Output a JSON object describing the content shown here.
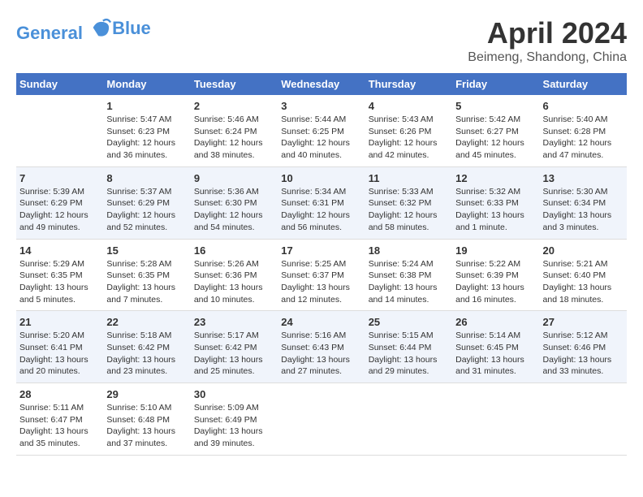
{
  "logo": {
    "line1": "General",
    "line2": "Blue"
  },
  "title": "April 2024",
  "subtitle": "Beimeng, Shandong, China",
  "days_header": [
    "Sunday",
    "Monday",
    "Tuesday",
    "Wednesday",
    "Thursday",
    "Friday",
    "Saturday"
  ],
  "weeks": [
    [
      {
        "day": "",
        "info": ""
      },
      {
        "day": "1",
        "info": "Sunrise: 5:47 AM\nSunset: 6:23 PM\nDaylight: 12 hours\nand 36 minutes."
      },
      {
        "day": "2",
        "info": "Sunrise: 5:46 AM\nSunset: 6:24 PM\nDaylight: 12 hours\nand 38 minutes."
      },
      {
        "day": "3",
        "info": "Sunrise: 5:44 AM\nSunset: 6:25 PM\nDaylight: 12 hours\nand 40 minutes."
      },
      {
        "day": "4",
        "info": "Sunrise: 5:43 AM\nSunset: 6:26 PM\nDaylight: 12 hours\nand 42 minutes."
      },
      {
        "day": "5",
        "info": "Sunrise: 5:42 AM\nSunset: 6:27 PM\nDaylight: 12 hours\nand 45 minutes."
      },
      {
        "day": "6",
        "info": "Sunrise: 5:40 AM\nSunset: 6:28 PM\nDaylight: 12 hours\nand 47 minutes."
      }
    ],
    [
      {
        "day": "7",
        "info": "Sunrise: 5:39 AM\nSunset: 6:29 PM\nDaylight: 12 hours\nand 49 minutes."
      },
      {
        "day": "8",
        "info": "Sunrise: 5:37 AM\nSunset: 6:29 PM\nDaylight: 12 hours\nand 52 minutes."
      },
      {
        "day": "9",
        "info": "Sunrise: 5:36 AM\nSunset: 6:30 PM\nDaylight: 12 hours\nand 54 minutes."
      },
      {
        "day": "10",
        "info": "Sunrise: 5:34 AM\nSunset: 6:31 PM\nDaylight: 12 hours\nand 56 minutes."
      },
      {
        "day": "11",
        "info": "Sunrise: 5:33 AM\nSunset: 6:32 PM\nDaylight: 12 hours\nand 58 minutes."
      },
      {
        "day": "12",
        "info": "Sunrise: 5:32 AM\nSunset: 6:33 PM\nDaylight: 13 hours\nand 1 minute."
      },
      {
        "day": "13",
        "info": "Sunrise: 5:30 AM\nSunset: 6:34 PM\nDaylight: 13 hours\nand 3 minutes."
      }
    ],
    [
      {
        "day": "14",
        "info": "Sunrise: 5:29 AM\nSunset: 6:35 PM\nDaylight: 13 hours\nand 5 minutes."
      },
      {
        "day": "15",
        "info": "Sunrise: 5:28 AM\nSunset: 6:35 PM\nDaylight: 13 hours\nand 7 minutes."
      },
      {
        "day": "16",
        "info": "Sunrise: 5:26 AM\nSunset: 6:36 PM\nDaylight: 13 hours\nand 10 minutes."
      },
      {
        "day": "17",
        "info": "Sunrise: 5:25 AM\nSunset: 6:37 PM\nDaylight: 13 hours\nand 12 minutes."
      },
      {
        "day": "18",
        "info": "Sunrise: 5:24 AM\nSunset: 6:38 PM\nDaylight: 13 hours\nand 14 minutes."
      },
      {
        "day": "19",
        "info": "Sunrise: 5:22 AM\nSunset: 6:39 PM\nDaylight: 13 hours\nand 16 minutes."
      },
      {
        "day": "20",
        "info": "Sunrise: 5:21 AM\nSunset: 6:40 PM\nDaylight: 13 hours\nand 18 minutes."
      }
    ],
    [
      {
        "day": "21",
        "info": "Sunrise: 5:20 AM\nSunset: 6:41 PM\nDaylight: 13 hours\nand 20 minutes."
      },
      {
        "day": "22",
        "info": "Sunrise: 5:18 AM\nSunset: 6:42 PM\nDaylight: 13 hours\nand 23 minutes."
      },
      {
        "day": "23",
        "info": "Sunrise: 5:17 AM\nSunset: 6:42 PM\nDaylight: 13 hours\nand 25 minutes."
      },
      {
        "day": "24",
        "info": "Sunrise: 5:16 AM\nSunset: 6:43 PM\nDaylight: 13 hours\nand 27 minutes."
      },
      {
        "day": "25",
        "info": "Sunrise: 5:15 AM\nSunset: 6:44 PM\nDaylight: 13 hours\nand 29 minutes."
      },
      {
        "day": "26",
        "info": "Sunrise: 5:14 AM\nSunset: 6:45 PM\nDaylight: 13 hours\nand 31 minutes."
      },
      {
        "day": "27",
        "info": "Sunrise: 5:12 AM\nSunset: 6:46 PM\nDaylight: 13 hours\nand 33 minutes."
      }
    ],
    [
      {
        "day": "28",
        "info": "Sunrise: 5:11 AM\nSunset: 6:47 PM\nDaylight: 13 hours\nand 35 minutes."
      },
      {
        "day": "29",
        "info": "Sunrise: 5:10 AM\nSunset: 6:48 PM\nDaylight: 13 hours\nand 37 minutes."
      },
      {
        "day": "30",
        "info": "Sunrise: 5:09 AM\nSunset: 6:49 PM\nDaylight: 13 hours\nand 39 minutes."
      },
      {
        "day": "",
        "info": ""
      },
      {
        "day": "",
        "info": ""
      },
      {
        "day": "",
        "info": ""
      },
      {
        "day": "",
        "info": ""
      }
    ]
  ]
}
